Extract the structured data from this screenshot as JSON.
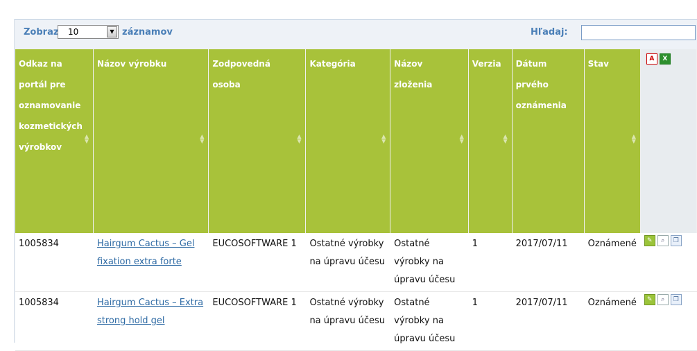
{
  "controls": {
    "show_label": "Zobraz",
    "page_size": "10",
    "records_label": "záznamov",
    "search_label": "Hľadaj:",
    "search_value": ""
  },
  "columns": [
    {
      "label": "Odkaz na portál pre oznamovanie kozmetických výrobkov"
    },
    {
      "label": "Názov výrobku"
    },
    {
      "label": "Zodpovedná osoba"
    },
    {
      "label": "Kategória"
    },
    {
      "label": "Názov zloženia"
    },
    {
      "label": "Verzia"
    },
    {
      "label": "Dátum prvého oznámenia"
    },
    {
      "label": "Stav"
    }
  ],
  "export_icons": [
    "pdf-export-icon",
    "excel-export-icon"
  ],
  "row_icons": [
    "edit-icon",
    "view-icon",
    "copy-icon"
  ],
  "rows": [
    {
      "id": "1005834",
      "product": "Hairgum Cactus – Gel fixation extra forte",
      "person": "EUCOSOFTWARE 1",
      "category": "Ostatné výrobky na úpravu účesu",
      "formula": "Ostatné výrobky na úpravu účesu",
      "version": "1",
      "date": "2017/07/11",
      "status": "Oznámené"
    },
    {
      "id": "1005834",
      "product": "Hairgum Cactus – Extra strong hold gel",
      "person": "EUCOSOFTWARE 1",
      "category": "Ostatné výrobky na úpravu účesu",
      "formula": "Ostatné výrobky na úpravu účesu",
      "version": "1",
      "date": "2017/07/11",
      "status": "Oznámené"
    }
  ]
}
